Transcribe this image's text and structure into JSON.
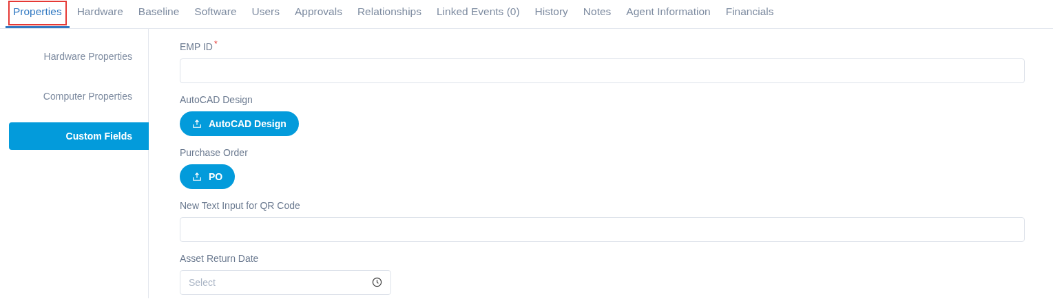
{
  "tabs": [
    {
      "label": "Properties",
      "selected": true,
      "highlighted": true
    },
    {
      "label": "Hardware",
      "selected": false,
      "highlighted": false
    },
    {
      "label": "Baseline",
      "selected": false,
      "highlighted": false
    },
    {
      "label": "Software",
      "selected": false,
      "highlighted": false
    },
    {
      "label": "Users",
      "selected": false,
      "highlighted": false
    },
    {
      "label": "Approvals",
      "selected": false,
      "highlighted": false
    },
    {
      "label": "Relationships",
      "selected": false,
      "highlighted": false
    },
    {
      "label": "Linked Events (0)",
      "selected": false,
      "highlighted": false
    },
    {
      "label": "History",
      "selected": false,
      "highlighted": false
    },
    {
      "label": "Notes",
      "selected": false,
      "highlighted": false
    },
    {
      "label": "Agent Information",
      "selected": false,
      "highlighted": false
    },
    {
      "label": "Financials",
      "selected": false,
      "highlighted": false
    }
  ],
  "sidebar": {
    "items": [
      {
        "label": "Hardware Properties",
        "selected": false
      },
      {
        "label": "Computer Properties",
        "selected": false
      },
      {
        "label": "Custom Fields",
        "selected": true
      }
    ]
  },
  "fields": [
    {
      "kind": "text",
      "label": "EMP ID",
      "required_mark": "*"
    },
    {
      "kind": "upload",
      "label": "AutoCAD Design",
      "button": "AutoCAD Design"
    },
    {
      "kind": "upload",
      "label": "Purchase Order",
      "button": "PO"
    },
    {
      "kind": "text",
      "label": "New Text Input for QR Code"
    },
    {
      "kind": "date",
      "label": "Asset Return Date",
      "placeholder": "Select"
    }
  ]
}
